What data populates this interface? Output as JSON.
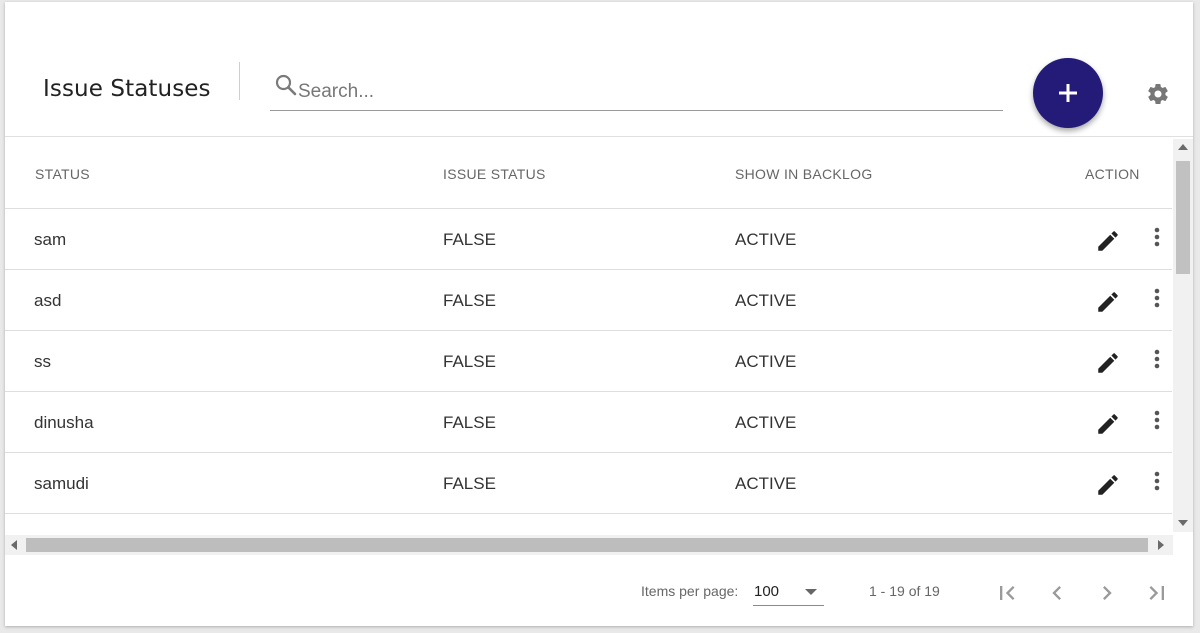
{
  "header": {
    "title": "Issue Statuses",
    "search_placeholder": "Search..."
  },
  "table": {
    "columns": [
      "STATUS",
      "ISSUE STATUS",
      "SHOW IN BACKLOG",
      "ACTION"
    ],
    "rows": [
      {
        "status": "sam",
        "issue_status": "FALSE",
        "show_in_backlog": "ACTIVE"
      },
      {
        "status": "asd",
        "issue_status": "FALSE",
        "show_in_backlog": "ACTIVE"
      },
      {
        "status": "ss",
        "issue_status": "FALSE",
        "show_in_backlog": "ACTIVE"
      },
      {
        "status": "dinusha",
        "issue_status": "FALSE",
        "show_in_backlog": "ACTIVE"
      },
      {
        "status": "samudi",
        "issue_status": "FALSE",
        "show_in_backlog": "ACTIVE"
      }
    ]
  },
  "paginator": {
    "items_per_page_label": "Items per page:",
    "page_size": "100",
    "range_label": "1 - 19 of 19"
  },
  "icons": {
    "add": "plus-icon",
    "settings": "gear-icon",
    "search": "search-icon",
    "edit": "pencil-icon",
    "more": "more-vert-icon"
  },
  "colors": {
    "fab": "#241b78",
    "icon": "#222222",
    "muted": "#777777"
  }
}
